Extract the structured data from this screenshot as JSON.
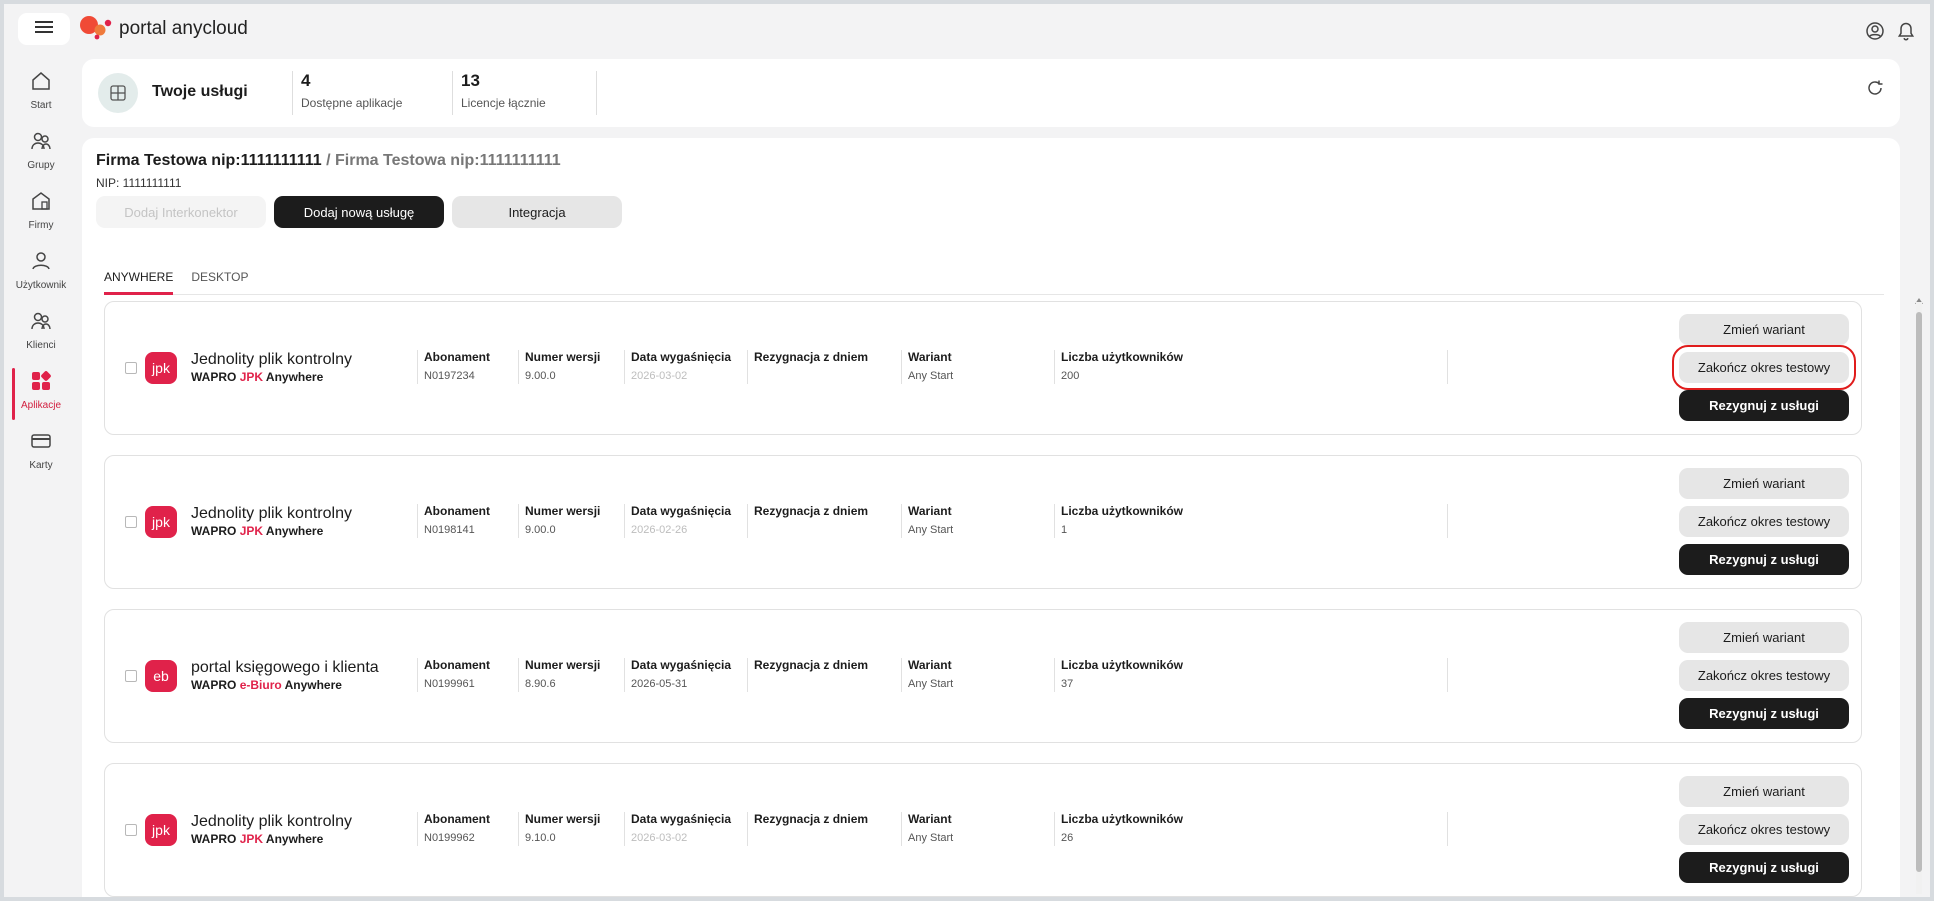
{
  "app": {
    "title": "portal anycloud",
    "icons": {
      "menu": "hamburger-icon",
      "user": "user-circle-icon",
      "bell": "bell-icon"
    }
  },
  "sidebar": {
    "items": [
      {
        "label": "Start",
        "icon": "home-icon"
      },
      {
        "label": "Grupy",
        "icon": "group-icon"
      },
      {
        "label": "Firmy",
        "icon": "building-icon"
      },
      {
        "label": "Użytkownik",
        "icon": "user-icon"
      },
      {
        "label": "Klienci",
        "icon": "clients-icon"
      },
      {
        "label": "Aplikacje",
        "icon": "apps-icon",
        "active": true
      },
      {
        "label": "Karty",
        "icon": "card-icon"
      }
    ]
  },
  "header": {
    "title": "Twoje usługi",
    "stats": [
      {
        "value": "4",
        "caption": "Dostępne aplikacje"
      },
      {
        "value": "13",
        "caption": "Licencje łącznie"
      }
    ]
  },
  "main": {
    "breadcrumb": {
      "first": "Firma Testowa nip:1111111111",
      "separator": " / ",
      "second": "Firma Testowa nip:1111111111"
    },
    "nip": "NIP: 1111111111",
    "buttons": {
      "add_connector": "Dodaj Interkonektor",
      "add_service": "Dodaj nową usługę",
      "integration": "Integracja"
    },
    "tabs": [
      {
        "label": "ANYWHERE",
        "active": true
      },
      {
        "label": "DESKTOP"
      }
    ],
    "field_labels": {
      "subscription": "Abonament",
      "version": "Numer wersji",
      "expiry": "Data wygaśnięcia",
      "resignation": "Rezygnacja z dniem",
      "variant": "Wariant",
      "users": "Liczba użytkowników"
    },
    "actions": {
      "change_variant": "Zmień wariant",
      "end_trial": "Zakończ okres testowy",
      "resign": "Rezygnuj z usługi"
    },
    "services": [
      {
        "icon_text": "jpk",
        "name": "Jednolity plik kontrolny",
        "brand": "WAPRO",
        "product": "JPK",
        "suffix": "Anywhere",
        "subscription": "N0197234",
        "version": "9.00.0",
        "expiry": "2026-03-02",
        "expiry_muted": true,
        "resignation": "",
        "variant": "Any Start",
        "users": "200",
        "highlight_end_trial": true
      },
      {
        "icon_text": "jpk",
        "name": "Jednolity plik kontrolny",
        "brand": "WAPRO",
        "product": "JPK",
        "suffix": "Anywhere",
        "subscription": "N0198141",
        "version": "9.00.0",
        "expiry": "2026-02-26",
        "expiry_muted": true,
        "resignation": "",
        "variant": "Any Start",
        "users": "1"
      },
      {
        "icon_text": "eb",
        "name": "portal księgowego i klienta",
        "brand": "WAPRO",
        "product": "e-Biuro",
        "suffix": "Anywhere",
        "subscription": "N0199961",
        "version": "8.90.6",
        "expiry": "2026-05-31",
        "expiry_muted": false,
        "resignation": "",
        "variant": "Any Start",
        "users": "37"
      },
      {
        "icon_text": "jpk",
        "name": "Jednolity plik kontrolny",
        "brand": "WAPRO",
        "product": "JPK",
        "suffix": "Anywhere",
        "subscription": "N0199962",
        "version": "9.10.0",
        "expiry": "2026-03-02",
        "expiry_muted": true,
        "resignation": "",
        "variant": "Any Start",
        "users": "26"
      }
    ]
  },
  "colors": {
    "accent": "#e0224a",
    "dark_button": "#1c1c1c",
    "highlight_box": "#e01c1c"
  }
}
